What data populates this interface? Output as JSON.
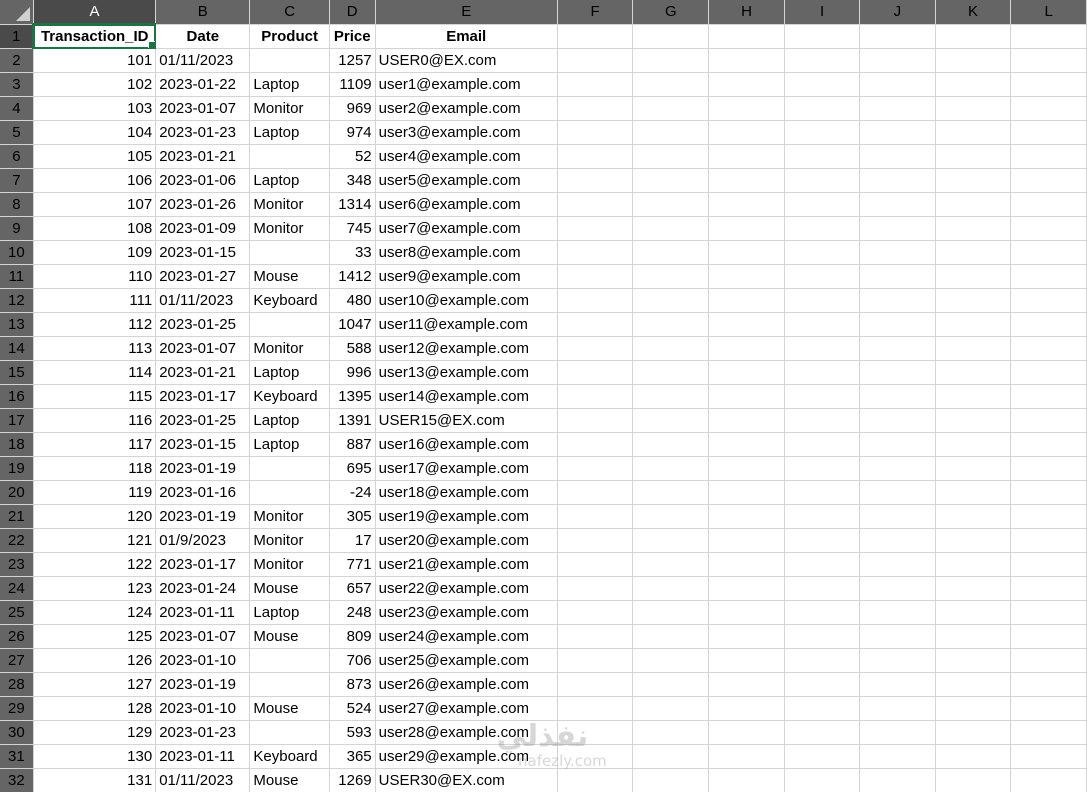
{
  "columns": [
    "A",
    "B",
    "C",
    "D",
    "E",
    "F",
    "G",
    "H",
    "I",
    "J",
    "K",
    "L"
  ],
  "active_column": "A",
  "active_row": 1,
  "headers": [
    "Transaction_ID",
    "Date",
    "Product",
    "Price",
    "Email"
  ],
  "rows": [
    {
      "row": 2,
      "id": "101",
      "date": "01/11/2023",
      "product": "",
      "price": "1257",
      "email": "USER0@EX.com"
    },
    {
      "row": 3,
      "id": "102",
      "date": "2023-01-22",
      "product": "Laptop",
      "price": "1109",
      "email": "user1@example.com"
    },
    {
      "row": 4,
      "id": "103",
      "date": "2023-01-07",
      "product": "Monitor",
      "price": "969",
      "email": "user2@example.com"
    },
    {
      "row": 5,
      "id": "104",
      "date": "2023-01-23",
      "product": "Laptop",
      "price": "974",
      "email": "user3@example.com"
    },
    {
      "row": 6,
      "id": "105",
      "date": "2023-01-21",
      "product": "",
      "price": "52",
      "email": "user4@example.com"
    },
    {
      "row": 7,
      "id": "106",
      "date": "2023-01-06",
      "product": "Laptop",
      "price": "348",
      "email": "user5@example.com"
    },
    {
      "row": 8,
      "id": "107",
      "date": "2023-01-26",
      "product": "Monitor",
      "price": "1314",
      "email": "user6@example.com"
    },
    {
      "row": 9,
      "id": "108",
      "date": "2023-01-09",
      "product": "Monitor",
      "price": "745",
      "email": "user7@example.com"
    },
    {
      "row": 10,
      "id": "109",
      "date": "2023-01-15",
      "product": "",
      "price": "33",
      "email": "user8@example.com"
    },
    {
      "row": 11,
      "id": "110",
      "date": "2023-01-27",
      "product": "Mouse",
      "price": "1412",
      "email": "user9@example.com"
    },
    {
      "row": 12,
      "id": "111",
      "date": "01/11/2023",
      "product": "Keyboard",
      "price": "480",
      "email": "user10@example.com"
    },
    {
      "row": 13,
      "id": "112",
      "date": "2023-01-25",
      "product": "",
      "price": "1047",
      "email": "user11@example.com"
    },
    {
      "row": 14,
      "id": "113",
      "date": "2023-01-07",
      "product": "Monitor",
      "price": "588",
      "email": "user12@example.com"
    },
    {
      "row": 15,
      "id": "114",
      "date": "2023-01-21",
      "product": "Laptop",
      "price": "996",
      "email": "user13@example.com"
    },
    {
      "row": 16,
      "id": "115",
      "date": "2023-01-17",
      "product": "Keyboard",
      "price": "1395",
      "email": "user14@example.com"
    },
    {
      "row": 17,
      "id": "116",
      "date": "2023-01-25",
      "product": "Laptop",
      "price": "1391",
      "email": "USER15@EX.com"
    },
    {
      "row": 18,
      "id": "117",
      "date": "2023-01-15",
      "product": "Laptop",
      "price": "887",
      "email": "user16@example.com"
    },
    {
      "row": 19,
      "id": "118",
      "date": "2023-01-19",
      "product": "",
      "price": "695",
      "email": "user17@example.com"
    },
    {
      "row": 20,
      "id": "119",
      "date": "2023-01-16",
      "product": "",
      "price": "-24",
      "email": "user18@example.com"
    },
    {
      "row": 21,
      "id": "120",
      "date": "2023-01-19",
      "product": "Monitor",
      "price": "305",
      "email": "user19@example.com"
    },
    {
      "row": 22,
      "id": "121",
      "date": "01/9/2023",
      "product": "Monitor",
      "price": "17",
      "email": "user20@example.com"
    },
    {
      "row": 23,
      "id": "122",
      "date": "2023-01-17",
      "product": "Monitor",
      "price": "771",
      "email": "user21@example.com"
    },
    {
      "row": 24,
      "id": "123",
      "date": "2023-01-24",
      "product": "Mouse",
      "price": "657",
      "email": "user22@example.com"
    },
    {
      "row": 25,
      "id": "124",
      "date": "2023-01-11",
      "product": "Laptop",
      "price": "248",
      "email": "user23@example.com"
    },
    {
      "row": 26,
      "id": "125",
      "date": "2023-01-07",
      "product": "Mouse",
      "price": "809",
      "email": "user24@example.com"
    },
    {
      "row": 27,
      "id": "126",
      "date": "2023-01-10",
      "product": "",
      "price": "706",
      "email": "user25@example.com"
    },
    {
      "row": 28,
      "id": "127",
      "date": "2023-01-19",
      "product": "",
      "price": "873",
      "email": "user26@example.com"
    },
    {
      "row": 29,
      "id": "128",
      "date": "2023-01-10",
      "product": "Mouse",
      "price": "524",
      "email": "user27@example.com"
    },
    {
      "row": 30,
      "id": "129",
      "date": "2023-01-23",
      "product": "",
      "price": "593",
      "email": "user28@example.com"
    },
    {
      "row": 31,
      "id": "130",
      "date": "2023-01-11",
      "product": "Keyboard",
      "price": "365",
      "email": "user29@example.com"
    },
    {
      "row": 32,
      "id": "131",
      "date": "01/11/2023",
      "product": "Mouse",
      "price": "1269",
      "email": "USER30@EX.com"
    }
  ],
  "watermark": {
    "logo": "نفذلي",
    "url": "nafezly.com"
  },
  "colors": {
    "header_bg": "#656565",
    "selected_header_bg": "#4a4a4a",
    "selection_green": "#1e7145",
    "gridline": "#d4d4d4"
  }
}
